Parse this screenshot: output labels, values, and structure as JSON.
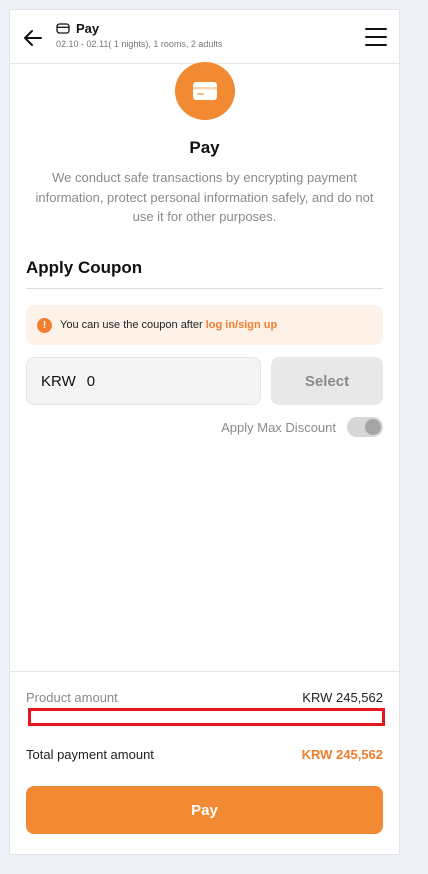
{
  "colors": {
    "accent": "#f18a32",
    "accent_text": "#ef7e2e",
    "notice_bg": "#fdf1e8",
    "highlight": "#e8141d"
  },
  "header": {
    "back_icon": "arrow-left-icon",
    "title_icon": "card-icon",
    "title": "Pay",
    "subtitle": "02.10 - 02.11( 1 nights), 1 rooms, 2 adults",
    "menu_icon": "hamburger-menu-icon"
  },
  "hero": {
    "icon": "card-icon",
    "title": "Pay",
    "description": "We conduct safe transactions by encrypting payment information, protect personal information safely, and do not use it for other purposes."
  },
  "coupon": {
    "section_title": "Apply Coupon",
    "notice_text": "You can use the coupon after",
    "notice_link": "log in/sign up",
    "currency": "KRW",
    "value": "0",
    "select_label": "Select",
    "max_discount_label": "Apply Max Discount",
    "max_discount_enabled": false
  },
  "summary": {
    "product_amount_label": "Product amount",
    "product_amount_value": "KRW 245,562",
    "total_label": "Total payment amount",
    "total_value": "KRW 245,562",
    "pay_label": "Pay"
  }
}
